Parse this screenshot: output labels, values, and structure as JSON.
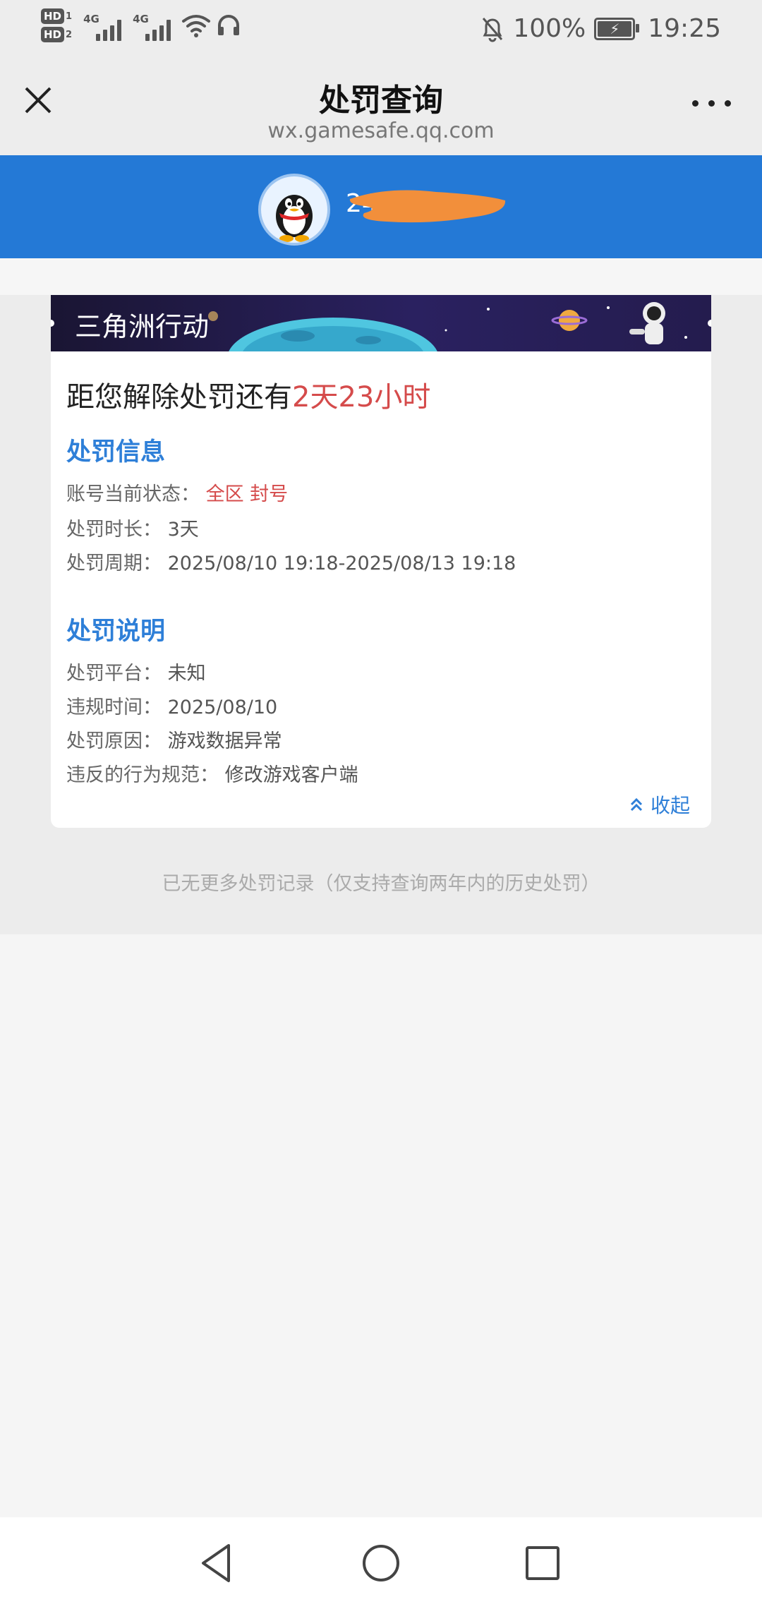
{
  "status_bar": {
    "sim1_label": "HD",
    "sim1_num": "1",
    "sim2_label": "HD",
    "sim2_num": "2",
    "net1": "4G",
    "net2": "4G",
    "battery": "100%",
    "time": "19:25"
  },
  "nav": {
    "title": "处罚查询",
    "url": "wx.gamesafe.qq.com"
  },
  "account": {
    "id_visible": "24362"
  },
  "card": {
    "game_name": "三角洲行动",
    "countdown_prefix": "距您解除处罚还有",
    "countdown_value": "2天23小时",
    "punish_info": {
      "title": "处罚信息",
      "status_label": "账号当前状态：",
      "status_value": "全区 封号",
      "duration_label": "处罚时长：",
      "duration_value": "3天",
      "period_label": "处罚周期：",
      "period_value": "2025/08/10 19:18-2025/08/13 19:18"
    },
    "punish_desc": {
      "title": "处罚说明",
      "platform_label": "处罚平台：",
      "platform_value": "未知",
      "time_label": "违规时间：",
      "time_value": "2025/08/10",
      "reason_label": "处罚原因：",
      "reason_value": "游戏数据异常",
      "rule_label": "违反的行为规范：",
      "rule_value": "修改游戏客户端"
    },
    "collapse_label": "收起"
  },
  "footer_note": "已无更多处罚记录（仅支持查询两年内的历史处罚）",
  "colors": {
    "brand_blue": "#2479d6",
    "accent_blue": "#2e7fd8",
    "alert_red": "#d54b4b"
  }
}
